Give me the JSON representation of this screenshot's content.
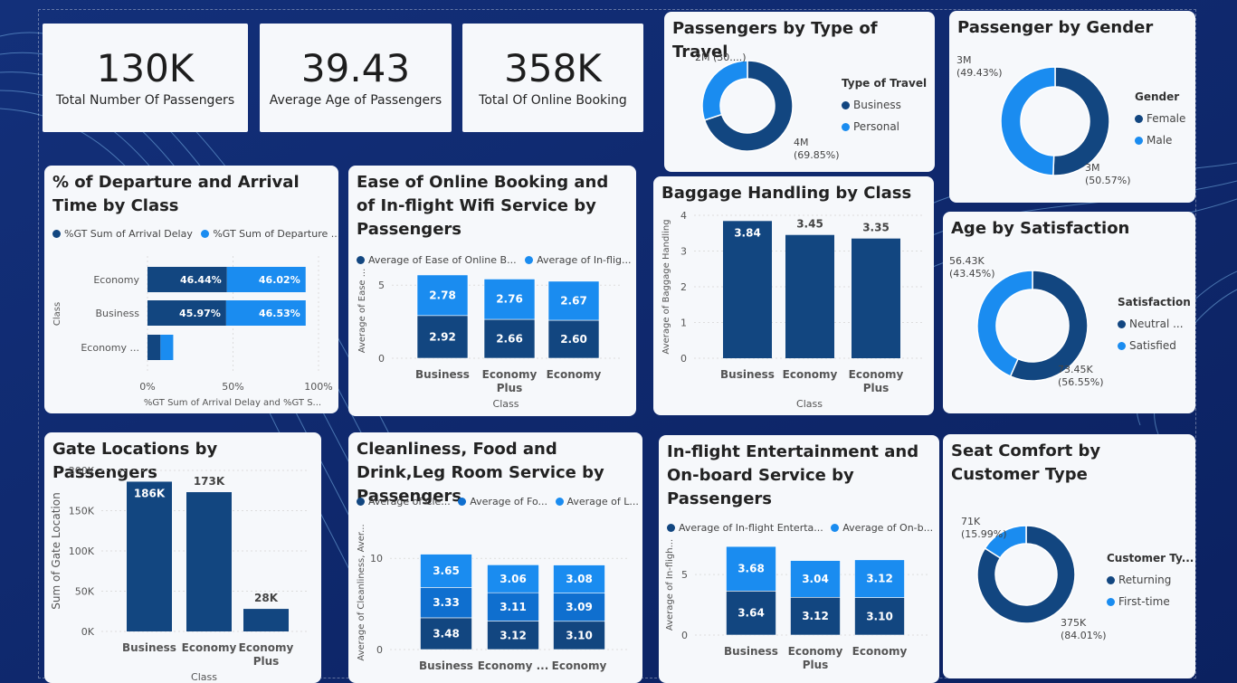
{
  "colors": {
    "dark": "#124680",
    "mid": "#0f6fcf",
    "light": "#1a8cf0",
    "text": "#333333"
  },
  "kpis": [
    {
      "value": "130K",
      "label": "Total Number Of Passengers"
    },
    {
      "value": "39.43",
      "label": "Average Age of Passengers"
    },
    {
      "value": "358K",
      "label": "Total Of Online Booking"
    }
  ],
  "chart_data": [
    {
      "id": "type_travel",
      "type": "pie",
      "title": "Passengers by Type of Travel",
      "legend_title": "Type of Travel",
      "labels": [
        "Business",
        "Personal"
      ],
      "values": [
        69.85,
        30.15
      ],
      "data_labels": [
        {
          "value": "4M",
          "pct": "(69.85%)"
        },
        {
          "value": "2M (30....)",
          "pct": ""
        }
      ]
    },
    {
      "id": "gender",
      "type": "pie",
      "title": "Passenger by Gender",
      "legend_title": "Gender",
      "labels": [
        "Female",
        "Male"
      ],
      "values": [
        50.57,
        49.43
      ],
      "data_labels": [
        {
          "value": "3M",
          "pct": "(50.57%)"
        },
        {
          "value": "3M",
          "pct": "(49.43%)"
        }
      ]
    },
    {
      "id": "age_sat",
      "type": "pie",
      "title": "Age by Satisfaction",
      "legend_title": "Satisfaction",
      "labels": [
        "Neutral ...",
        "Satisfied"
      ],
      "values": [
        56.55,
        43.45
      ],
      "data_labels": [
        {
          "value": "73.45K",
          "pct": "(56.55%)"
        },
        {
          "value": "56.43K",
          "pct": "(43.45%)"
        }
      ]
    },
    {
      "id": "seat",
      "type": "pie",
      "title": "Seat Comfort by Customer Type",
      "legend_title": "Customer Ty...",
      "labels": [
        "Returning",
        "First-time"
      ],
      "values": [
        84.01,
        15.99
      ],
      "data_labels": [
        {
          "value": "375K",
          "pct": "(84.01%)"
        },
        {
          "value": "71K",
          "pct": "(15.99%)"
        }
      ]
    },
    {
      "id": "dep_arr",
      "type": "bar",
      "orientation": "horizontal",
      "stacked": true,
      "title": "% of Departure and Arrival Time by Class",
      "categories": [
        "Economy",
        "Business",
        "Economy ..."
      ],
      "series": [
        {
          "name": "%GT Sum of Arrival Delay",
          "values": [
            46.44,
            45.97,
            7.59
          ]
        },
        {
          "name": "%GT Sum of Departure ...",
          "values": [
            46.02,
            46.53,
            7.45
          ]
        }
      ],
      "data_labels": [
        [
          "46.44%",
          "46.02%"
        ],
        [
          "45.97%",
          "46.53%"
        ],
        [
          "",
          ""
        ]
      ],
      "xticks": [
        "0%",
        "50%",
        "100%"
      ],
      "xlim": [
        0,
        100
      ],
      "xlabel": "%GT Sum of Arrival Delay and %GT S...",
      "ylabel": "Class"
    },
    {
      "id": "ease_wifi",
      "type": "bar",
      "stacked": true,
      "title": "Ease of Online Booking and of In-flight Wifi Service by Passengers",
      "categories": [
        [
          "Business"
        ],
        [
          "Economy",
          "Plus"
        ],
        [
          "Economy"
        ]
      ],
      "series": [
        {
          "name": "Average of Ease of Online B...",
          "values": [
            2.92,
            2.66,
            2.6
          ]
        },
        {
          "name": "Average of In-flig...",
          "values": [
            2.78,
            2.76,
            2.67
          ]
        }
      ],
      "yticks": [
        "0",
        "5"
      ],
      "ylim": [
        0,
        6.5
      ],
      "xlabel": "Class",
      "ylabel": "Average of Ease ..."
    },
    {
      "id": "baggage",
      "type": "bar",
      "title": "Baggage Handling by Class",
      "categories": [
        [
          "Business"
        ],
        [
          "Economy"
        ],
        [
          "Economy",
          "Plus"
        ]
      ],
      "values": [
        3.84,
        3.45,
        3.35
      ],
      "data_labels": [
        "3.84",
        "3.45",
        "3.35"
      ],
      "yticks": [
        "0",
        "1",
        "2",
        "3",
        "4"
      ],
      "ylim": [
        0,
        4
      ],
      "xlabel": "Class",
      "ylabel": "Average of Baggage Handling"
    },
    {
      "id": "gate",
      "type": "bar",
      "title": "Gate Locations by Passengers",
      "categories": [
        [
          "Business"
        ],
        [
          "Economy"
        ],
        [
          "Economy",
          "Plus"
        ]
      ],
      "values": [
        186000,
        173000,
        28000
      ],
      "data_labels": [
        "186K",
        "173K",
        "28K"
      ],
      "yticks": [
        "0K",
        "50K",
        "100K",
        "150K",
        "200K"
      ],
      "ylim": [
        0,
        200000
      ],
      "xlabel": "Class",
      "ylabel": "Sum of Gate Location"
    },
    {
      "id": "clean",
      "type": "bar",
      "stacked": true,
      "title": "Cleanliness, Food and Drink,Leg Room Service by Passengers",
      "categories": [
        [
          "Business"
        ],
        [
          "Economy ..."
        ],
        [
          "Economy"
        ]
      ],
      "series": [
        {
          "name": "Average of Cle...",
          "values": [
            3.48,
            3.12,
            3.1
          ]
        },
        {
          "name": "Average of Fo...",
          "values": [
            3.33,
            3.11,
            3.09
          ]
        },
        {
          "name": "Average of L...",
          "values": [
            3.65,
            3.06,
            3.08
          ]
        }
      ],
      "yticks": [
        "0",
        "10"
      ],
      "ylim": [
        0,
        12.5
      ],
      "xlabel": "",
      "ylabel": "Average of Cleanliness, Aver..."
    },
    {
      "id": "ent",
      "type": "bar",
      "stacked": true,
      "title": "In-flight Entertainment and On-board Service by Passengers",
      "categories": [
        [
          "Business"
        ],
        [
          "Economy",
          "Plus"
        ],
        [
          "Economy"
        ]
      ],
      "series": [
        {
          "name": "Average of In-flight Enterta...",
          "values": [
            3.64,
            3.12,
            3.1
          ]
        },
        {
          "name": "Average of On-b...",
          "values": [
            3.68,
            3.04,
            3.12
          ]
        }
      ],
      "yticks": [
        "0",
        "5"
      ],
      "ylim": [
        0,
        8.3
      ],
      "xlabel": "",
      "ylabel": "Average of In-fligh..."
    }
  ]
}
